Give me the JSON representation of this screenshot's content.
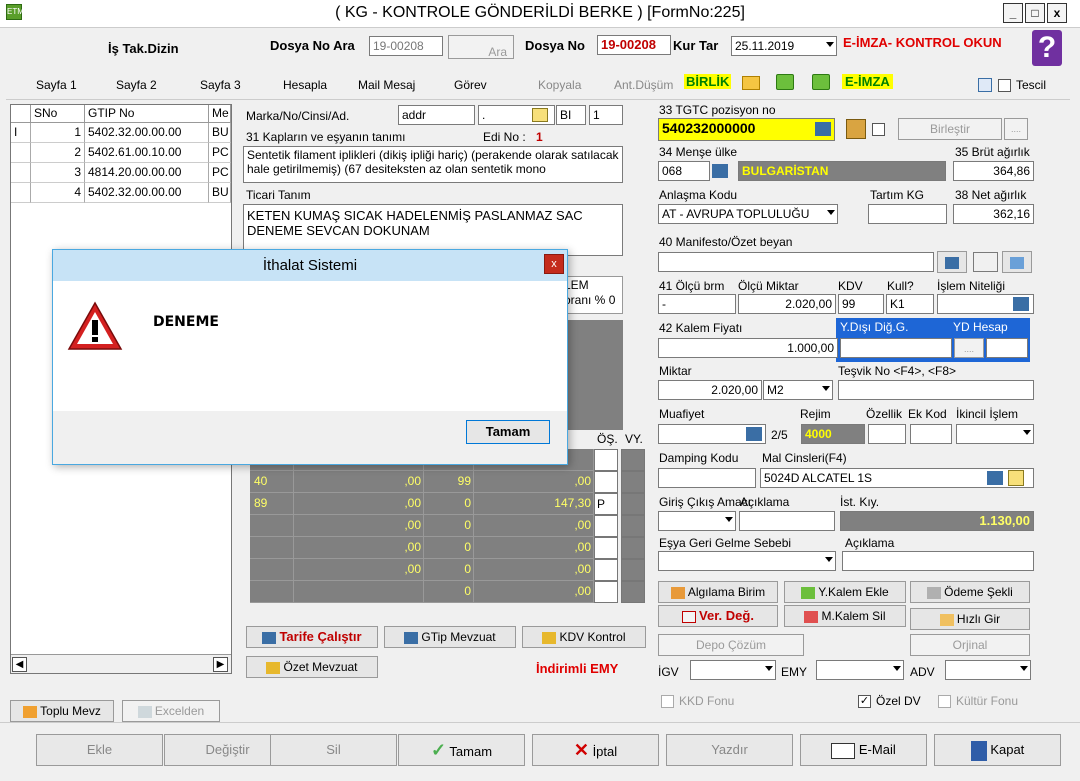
{
  "window": {
    "title": "( KG  - KONTROLE GÖNDERİLDİ BERKE ) [FormNo:225]",
    "min": "_",
    "max": "□",
    "close": "x"
  },
  "header": {
    "dizin": "İş Tak.Dizin",
    "dosya_ara_label": "Dosya No Ara",
    "dosya_ara_value": "19-00208",
    "ara_btn": "Ara",
    "dosya_no_label": "Dosya No",
    "dosya_no_value": "19-00208",
    "kur_tar_label": "Kur Tar",
    "kur_tar_value": "25.11.2019",
    "eimza_warning": "E-İMZA- KONTROL OKUN",
    "help": "?"
  },
  "tabs": {
    "sayfa1": "Sayfa 1",
    "sayfa2": "Sayfa 2",
    "sayfa3": "Sayfa 3",
    "hesapla": "Hesapla",
    "mail": "Mail Mesaj",
    "gorev": "Görev",
    "kopyala": "Kopyala",
    "antdusum": "Ant.Düşüm",
    "birlik": "BİRLİK",
    "eimza": "E-İMZA",
    "tescil": "Tescil"
  },
  "items_grid": {
    "headers": [
      "SNo",
      "GTIP No",
      "Me"
    ],
    "rows": [
      {
        "mark": "I",
        "sno": "1",
        "gtip": "5402.32.00.00.00",
        "me": "BU"
      },
      {
        "mark": "",
        "sno": "2",
        "gtip": "5402.61.00.10.00",
        "me": "PC"
      },
      {
        "mark": "",
        "sno": "3",
        "gtip": "4814.20.00.00.00",
        "me": "PC"
      },
      {
        "mark": "",
        "sno": "4",
        "gtip": "5402.32.00.00.00",
        "me": "BU"
      }
    ]
  },
  "left_buttons": {
    "toplu": "Toplu Mevz",
    "excel": "Excelden"
  },
  "form": {
    "marka_label": "Marka/No/Cinsi/Ad.",
    "marka_val1": "addr",
    "marka_val2": ".",
    "marka_val3": "BI",
    "marka_val4": "1",
    "kap_label": "31 Kapların ve eşyanın tanımı",
    "edino_label": "Edi No :",
    "edino_val": "1",
    "kap_text": "Sentetik filament iplikleri (dikiş ipliği hariç) (perakende olarak satılacak hale getirilmemiş) (67 desiteksten az olan sentetik mono",
    "ticari_label": "Ticari Tanım",
    "ticari_text": "KETEN KUMAŞ SICAK HADELENMİŞ PASLANMAZ SAC DENEME SEVCAN DOKUNAM",
    "kalem_frag": "LEM",
    "oran_frag": "oranı % 0",
    "os_label": "ÖŞ.",
    "vy_label": "VY.",
    "tarife_btn": "Tarife Çalıştır",
    "gtip_btn": "GTip Mevzuat",
    "kdv_btn": "KDV Kontrol",
    "ozet_btn": "Özet Mevzuat",
    "indirimli": "İndirimli EMY"
  },
  "tax_rows": [
    {
      "c1": "",
      "c2": "",
      "c3": "",
      "c4": "",
      "p": ""
    },
    {
      "c1": "40",
      ",00": "",
      "c2": ",00",
      "c3": "99",
      "c4": ",00",
      "p": ""
    },
    {
      "c1": "89",
      "c2": ",00",
      "c3": "0",
      "c4": "147,30",
      "p": "P"
    },
    {
      "c1": "",
      "c2": ",00",
      "c3": "0",
      "c4": ",00",
      "p": ""
    },
    {
      "c1": "",
      "c2": ",00",
      "c3": "0",
      "c4": ",00",
      "p": ""
    },
    {
      "c1": "",
      "c2": ",00",
      "c3": "0",
      "c4": ",00",
      "p": ""
    },
    {
      "c1": "",
      "c2": "",
      "c3": "0",
      "c4": ",00",
      "p": ""
    }
  ],
  "right": {
    "tgtc_label": "33 TGTC pozisyon no",
    "tgtc_val": "540232000000",
    "birlestir": "Birleştir",
    "dots": "....",
    "mense_label": "34 Menşe ülke",
    "mense_code": "068",
    "mense_name": "BULGARİSTAN",
    "brut_label": "35 Brüt ağırlık",
    "brut_val": "364,86",
    "anlasma_label": "Anlaşma Kodu",
    "anlasma_val": "AT    - AVRUPA TOPLULUĞU",
    "tartim_label": "Tartım KG",
    "net_label": "38 Net ağırlık",
    "net_val": "362,16",
    "manifesto_label": "40 Manifesto/Özet beyan",
    "olcu_label": "41 Ölçü brm",
    "olcu_miktar_label": "Ölçü Miktar",
    "kdv_label": "KDV",
    "kull_label": "Kull?",
    "islem_label": "İşlem Niteliği",
    "olcu_val": "-",
    "olcu_miktar_val": "2.020,00",
    "kdv_val": "99",
    "kull_val": "K1",
    "kalem_label": "42 Kalem Fiyatı",
    "kalem_val": "1.000,00",
    "ydisi_label": "Y.Dışı Diğ.G.",
    "ydhesap_label": "YD Hesap",
    "dots2": "....",
    "miktar_label": "Miktar",
    "miktar_val": "2.020,00",
    "miktar_unit": "M2",
    "tesvik_label": "Teşvik No <F4>, <F8>",
    "muafiyet_label": "Muafiyet",
    "rejim_label": "Rejim",
    "ozellik_label": "Özellik",
    "ekkod_label": "Ek Kod",
    "ikincil_label": "İkincil İşlem",
    "rejim_frac": "2/5",
    "rejim_val": "4000",
    "damping_label": "Damping Kodu",
    "mal_label": "Mal Cinsleri(F4)",
    "mal_val": "5024D ALCATEL 1S",
    "giris_label": "Giriş Çıkış Amacı",
    "aciklama_label": "Açıklama",
    "ist_label": "İst. Kıy.",
    "ist_val": "1.130,00",
    "esya_label": "Eşya Geri Gelme Sebebi",
    "aciklama2_label": "Açıklama",
    "algilama": "Algılama Birim",
    "ykalem": "Y.Kalem Ekle",
    "odeme": "Ödeme Şekli",
    "verdeg": "Ver. Değ.",
    "mkalem": "M.Kalem Sil",
    "hizli": "Hızlı Gir",
    "depo": "Depo Çözüm",
    "orjinal": "Orjinal",
    "igv_label": "İGV",
    "emy_label": "EMY",
    "adv_label": "ADV",
    "kkd_label": "KKD Fonu",
    "ozeldv_label": "Özel DV",
    "kultur_label": "Kültür Fonu"
  },
  "dialog": {
    "title": "İthalat Sistemi",
    "close": "x",
    "message": "DENEME",
    "ok": "Tamam"
  },
  "footer": {
    "ekle": "Ekle",
    "degistir": "Değiştir",
    "sil": "Sil",
    "tamam": "Tamam",
    "iptal": "İptal",
    "yazdir": "Yazdır",
    "email": "E-Mail",
    "kapat": "Kapat"
  }
}
